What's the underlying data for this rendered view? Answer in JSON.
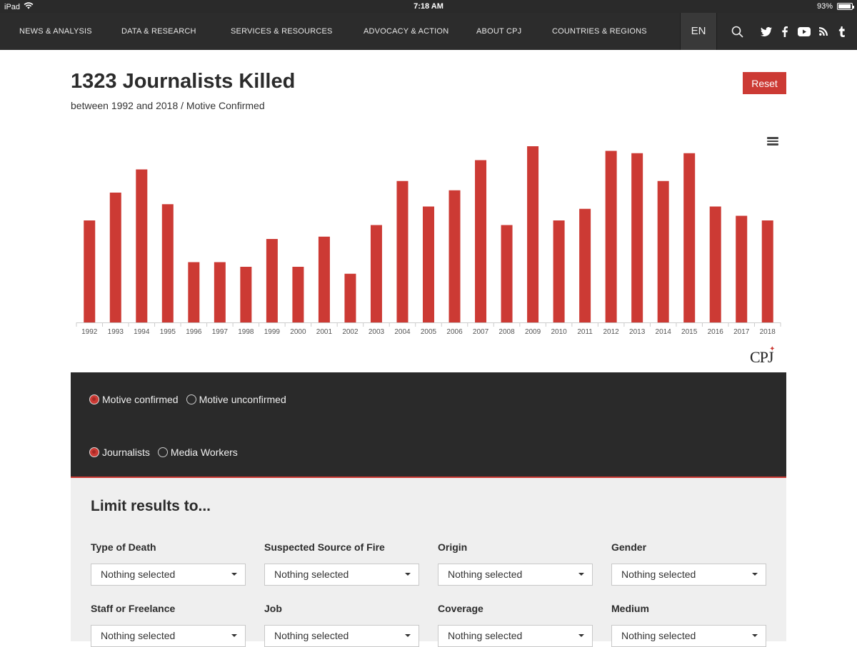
{
  "statusbar": {
    "device": "iPad",
    "time": "7:18 AM",
    "battery": "93%",
    "battery_level": 0.93
  },
  "nav": {
    "items": [
      "NEWS & ANALYSIS",
      "DATA & RESEARCH",
      "SERVICES & RESOURCES",
      "ADVOCACY & ACTION",
      "ABOUT CPJ",
      "COUNTRIES & REGIONS"
    ],
    "lang": "EN",
    "icons": [
      "search-icon",
      "twitter-icon",
      "facebook-icon",
      "youtube-icon",
      "rss-icon",
      "tumblr-icon"
    ]
  },
  "page": {
    "title": "1323 Journalists Killed",
    "subtitle": "between 1992 and 2018 / Motive Confirmed",
    "reset_label": "Reset"
  },
  "chart_data": {
    "type": "bar",
    "categories": [
      "1992",
      "1993",
      "1994",
      "1995",
      "1996",
      "1997",
      "1998",
      "1999",
      "2000",
      "2001",
      "2002",
      "2003",
      "2004",
      "2005",
      "2006",
      "2007",
      "2008",
      "2009",
      "2010",
      "2011",
      "2012",
      "2013",
      "2014",
      "2015",
      "2016",
      "2017",
      "2018"
    ],
    "values": [
      44,
      56,
      66,
      51,
      26,
      26,
      24,
      36,
      24,
      37,
      21,
      42,
      61,
      50,
      57,
      70,
      42,
      76,
      44,
      49,
      74,
      73,
      61,
      73,
      50,
      46,
      44
    ],
    "color": "#cc3a34",
    "ylim": [
      0,
      80
    ],
    "grid": false,
    "legend": "none"
  },
  "logo": {
    "text": "CPJ"
  },
  "filters": {
    "motive": [
      {
        "label": "Motive confirmed",
        "checked": true
      },
      {
        "label": "Motive unconfirmed",
        "checked": false
      }
    ],
    "type": [
      {
        "label": "Journalists",
        "checked": true
      },
      {
        "label": "Media Workers",
        "checked": false
      }
    ]
  },
  "limit": {
    "heading": "Limit results to...",
    "fields": [
      {
        "label": "Type of Death",
        "value": "Nothing selected"
      },
      {
        "label": "Suspected Source of Fire",
        "value": "Nothing selected"
      },
      {
        "label": "Origin",
        "value": "Nothing selected"
      },
      {
        "label": "Gender",
        "value": "Nothing selected"
      },
      {
        "label": "Staff or Freelance",
        "value": "Nothing selected"
      },
      {
        "label": "Job",
        "value": "Nothing selected"
      },
      {
        "label": "Coverage",
        "value": "Nothing selected"
      },
      {
        "label": "Medium",
        "value": "Nothing selected"
      }
    ]
  },
  "colors": {
    "accent": "#cc3a34",
    "nav_bg": "#2c2c2c",
    "panel_bg": "#2a2a2a",
    "limit_bg": "#efefef"
  }
}
